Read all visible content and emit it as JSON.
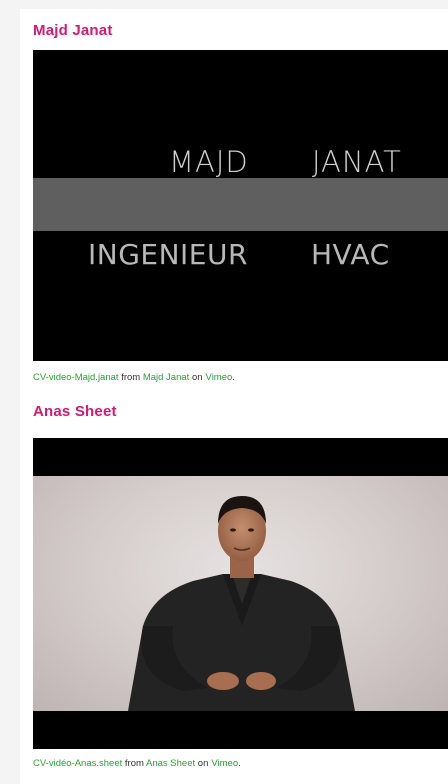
{
  "videos": [
    {
      "title": "Majd Janat",
      "screen": {
        "name_first": "MAJD",
        "name_last": "JANAT",
        "role_first": "INGENIEUR",
        "role_last": "HVAC"
      },
      "caption": {
        "video_link": "CV-video-Majd.janat",
        "from": "from",
        "author_link": "Majd Janat",
        "on": "on",
        "platform_link": "Vimeo",
        "end": "."
      }
    },
    {
      "title": "Anas Sheet",
      "caption": {
        "video_link": "CV-vidéo-Anas.sheet",
        "from": "from",
        "author_link": "Anas Sheet",
        "on": "on",
        "platform_link": "Vimeo",
        "end": "."
      }
    }
  ],
  "colors": {
    "title": "#d6186f",
    "link": "#2d9e37",
    "caption_text": "#333333"
  }
}
